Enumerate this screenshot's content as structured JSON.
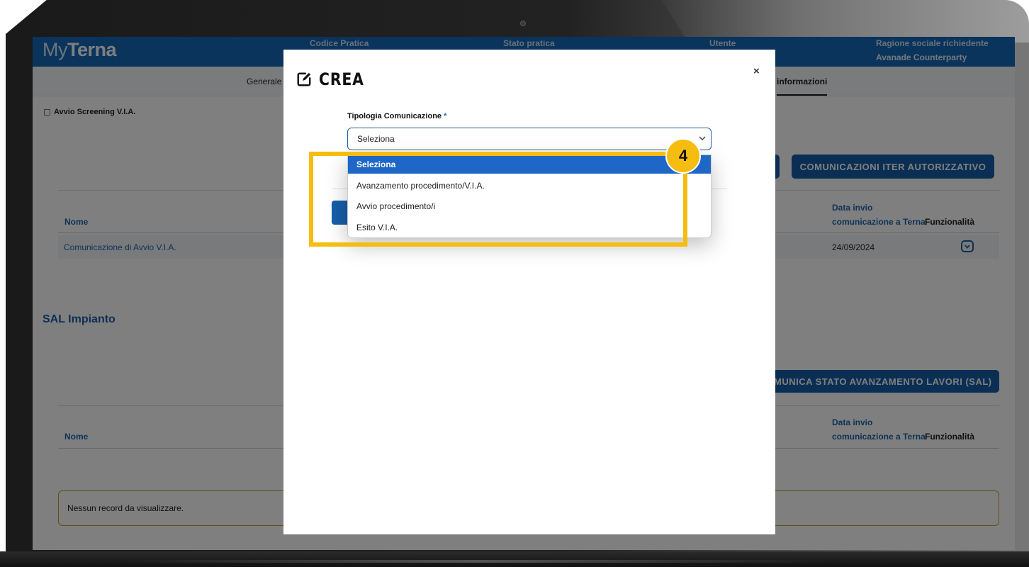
{
  "app": {
    "logo_my": "My",
    "logo_terna": "Terna"
  },
  "header": {
    "codice_pratica_label": "Codice Pratica",
    "stato_pratica_label": "Stato pratica",
    "utente_label": "Utente",
    "ragione_sociale_label": "Ragione sociale richiedente",
    "ragione_sociale_value": "Avanade Counterparty"
  },
  "tabs": {
    "generale": "Generale",
    "informazioni": "informazioni"
  },
  "page": {
    "checkbox_label": "Avvio Screening V.I.A.",
    "comunicazioni_button": "COMUNICAZIONI ITER AUTORIZZATIVO",
    "table1": {
      "col_nome": "Nome",
      "col_data_line1": "Data invio",
      "col_data_line2": "comunicazione a Terna",
      "col_funzionalita": "Funzionalità",
      "rows": [
        {
          "nome": "Comunicazione di Avvio V.I.A.",
          "data": "24/09/2024"
        }
      ]
    },
    "sal_title": "SAL Impianto",
    "sal_button": "MUNICA STATO AVANZAMENTO LAVORI (SAL)",
    "table2": {
      "col_nome": "Nome",
      "col_data_line1": "Data invio",
      "col_data_line2": "comunicazione a Terna",
      "col_funzionalita": "Funzionalità"
    },
    "empty_message": "Nessun record da visualizzare."
  },
  "modal": {
    "title": "CREA",
    "close": "×",
    "field_label": "Tipologia Comunicazione",
    "required_mark": "*",
    "select_value": "Seleziona",
    "options": [
      "Seleziona",
      "Avanzamento procedimento/V.I.A.",
      "Avvio procedimento/i",
      "Esito V.I.A."
    ],
    "selected_option": "Seleziona"
  },
  "annotation": {
    "step_number": "4"
  },
  "colors": {
    "brand_blue": "#1569b8",
    "button_blue": "#165fa8",
    "highlight_yellow": "#f5bd10"
  }
}
